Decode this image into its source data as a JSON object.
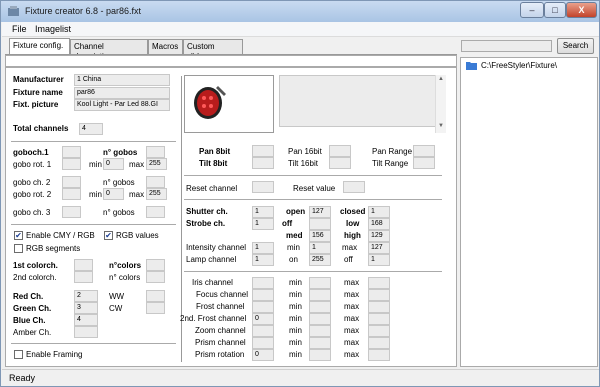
{
  "window": {
    "title": "Fixture creator 6.8 - par86.fxt",
    "minimize": "–",
    "maximize": "□",
    "close": "X"
  },
  "menu": [
    "File",
    "Imagelist"
  ],
  "tabs": [
    "Fixture config.",
    "Channel description",
    "Macros",
    "Custom sliders"
  ],
  "search": {
    "button": "Search",
    "value": ""
  },
  "tree": {
    "path": "C:\\FreeStyler\\Fixture\\"
  },
  "status": "Ready",
  "info": {
    "manufacturer_label": "Manufacturer",
    "manufacturer": "1 China",
    "name_label": "Fixture name",
    "name": "par86",
    "picture_label": "Fixt. picture",
    "picture": "Kool Light - Par Led 88.GI",
    "total_label": "Total channels",
    "total": "4"
  },
  "gobo": {
    "goboch1": "goboch.1",
    "n_gobos": "n° gobos",
    "rot1": "gobo rot. 1",
    "min": "min",
    "max": "max",
    "min_val": "0",
    "max_val": "255",
    "goboch2": "gobo ch. 2",
    "rot2": "gobo rot. 2",
    "goboch3": "gobo ch. 3"
  },
  "checks": {
    "cmy": "Enable CMY / RGB",
    "rgbvalues": "RGB values",
    "rgbseg": "RGB segments",
    "framing": "Enable Framing"
  },
  "color": {
    "c1": "1st colorch.",
    "ncolors": "n°colors",
    "c2": "2nd colorch.",
    "ncolors2": "n° colors",
    "red": "Red Ch.",
    "red_val": "2",
    "green": "Green Ch.",
    "green_val": "3",
    "blue": "Blue Ch.",
    "blue_val": "4",
    "amber": "Amber Ch.",
    "ww": "WW",
    "cw": "CW"
  },
  "pantilt": {
    "pan8": "Pan 8bit",
    "tilt8": "Tilt 8bit",
    "pan16": "Pan 16bit",
    "tilt16": "Tilt 16bit",
    "panrange": "Pan Range",
    "tiltrange": "Tilt Range"
  },
  "reset": {
    "channel": "Reset channel",
    "value": "Reset value"
  },
  "shutter": {
    "shutter_label": "Shutter ch.",
    "shutter_val": "1",
    "open": "open",
    "open_val": "127",
    "closed": "closed",
    "closed_val": "1",
    "strobe_label": "Strobe ch.",
    "strobe_val": "1",
    "off": "off",
    "low": "low",
    "low_val": "168",
    "med": "med",
    "med_val": "156",
    "high": "high",
    "high_val": "129"
  },
  "intensity": {
    "label": "Intensity channel",
    "val": "1",
    "min": "min",
    "min_val": "1",
    "max": "max",
    "max_val": "127"
  },
  "lamp": {
    "label": "Lamp channel",
    "val": "1",
    "on": "on",
    "on_val": "255",
    "off": "off",
    "off_val": "1"
  },
  "channels": [
    "Iris channel",
    "Focus channel",
    "Frost channel",
    "2nd. Frost channel",
    "Zoom channel",
    "Prism channel",
    "Prism rotation"
  ],
  "channel_values": {
    "frost2": "0",
    "prismrot": "0"
  },
  "minmax": {
    "min": "min",
    "max": "max"
  }
}
